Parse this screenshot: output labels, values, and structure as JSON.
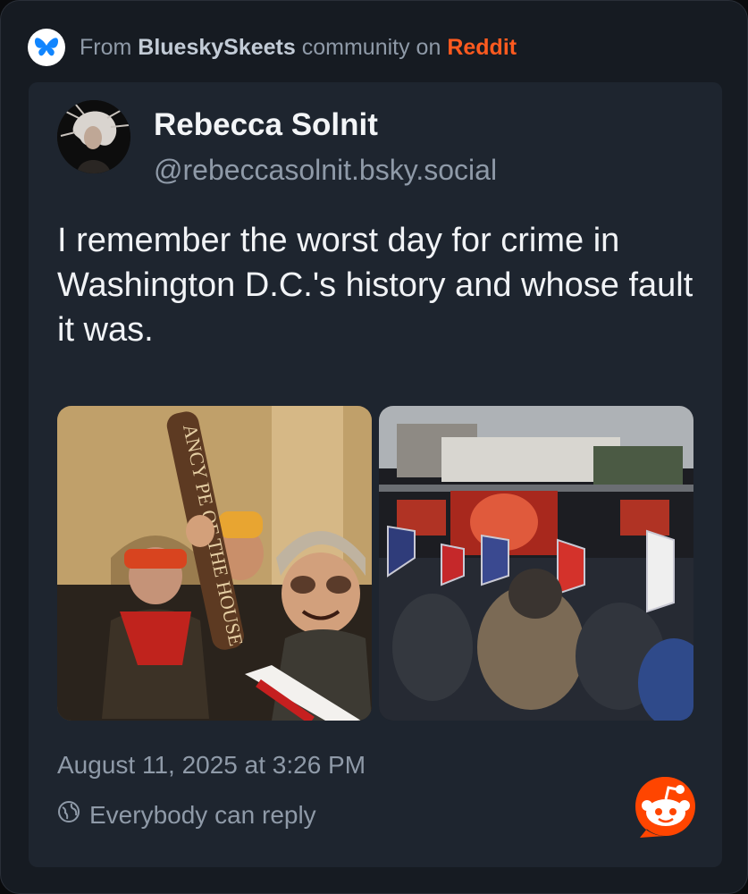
{
  "header": {
    "prefix": "From",
    "community": "BlueskySkeets",
    "middle": "community on",
    "platform": "Reddit",
    "icon": "bluesky-butterfly-icon"
  },
  "post": {
    "author_name": "Rebecca Solnit",
    "author_handle": "@rebeccasolnit.bsky.social",
    "text": "I remember the worst day for crime in Washington D.C.'s history and whose fault it was.",
    "timestamp": "August 11, 2025 at 3:26 PM",
    "reply_setting": "Everybody can reply",
    "images": [
      {
        "icon": "photo-rioters-capitol"
      },
      {
        "icon": "photo-rally-white-house"
      }
    ],
    "sign_text": "ANCY PE OF THE HOUSE"
  },
  "colors": {
    "background": "#161b22",
    "card": "#1e252f",
    "muted_text": "#8f9aa8",
    "reddit_orange": "#ff5a1f",
    "bluesky_blue": "#1185fe"
  }
}
